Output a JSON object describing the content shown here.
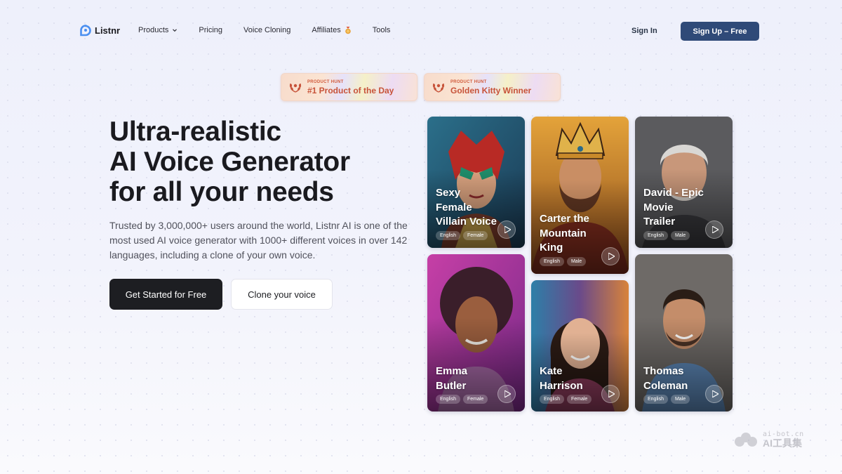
{
  "nav": {
    "logo": "Listnr",
    "links": [
      {
        "label": "Products"
      },
      {
        "label": "Pricing"
      },
      {
        "label": "Voice Cloning"
      },
      {
        "label": "Affiliates"
      },
      {
        "label": "Tools"
      }
    ],
    "sign_in": "Sign In",
    "sign_up": "Sign Up – Free"
  },
  "badges": [
    {
      "kicker": "PRODUCT HUNT",
      "title": "#1 Product of the Day"
    },
    {
      "kicker": "PRODUCT HUNT",
      "title": "Golden Kitty Winner"
    }
  ],
  "hero": {
    "title_lines": [
      "Ultra-realistic",
      "AI Voice Generator",
      "for all your needs"
    ],
    "description": "Trusted by 3,000,000+ users around the world, Listnr AI is one of the most used AI voice generator with 1000+ different voices in over 142 languages, including a clone of your own voice.",
    "cta_primary": "Get Started for Free",
    "cta_secondary": "Clone your voice"
  },
  "voices": [
    {
      "name_lines": [
        "Sexy",
        "Female",
        "Villain Voice"
      ],
      "language": "English",
      "gender": "Female"
    },
    {
      "name_lines": [
        "Carter the",
        "Mountain",
        "King"
      ],
      "language": "English",
      "gender": "Male"
    },
    {
      "name_lines": [
        "David - Epic",
        "Movie",
        "Trailer"
      ],
      "language": "English",
      "gender": "Male"
    },
    {
      "name_lines": [
        "Emma",
        "Butler"
      ],
      "language": "English",
      "gender": "Female"
    },
    {
      "name_lines": [
        "Kate",
        "Harrison"
      ],
      "language": "English",
      "gender": "Female"
    },
    {
      "name_lines": [
        "Thomas",
        "Coleman"
      ],
      "language": "English",
      "gender": "Male"
    }
  ],
  "watermark": {
    "url": "ai-bot.cn",
    "name": "AI工具集"
  },
  "colors": {
    "primary_button": "#1d1e22",
    "signup_button": "#2f4a78",
    "badge_text": "#c7533a"
  }
}
